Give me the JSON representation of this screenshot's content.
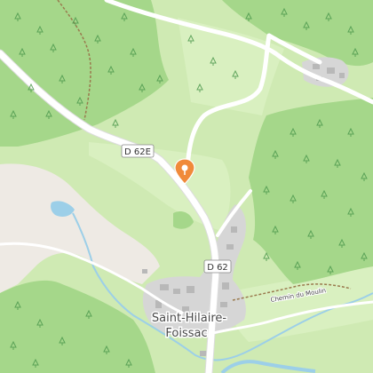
{
  "map": {
    "roads": [
      {
        "id": "road-d62e",
        "label": "D 62E"
      },
      {
        "id": "road-d62",
        "label": "D 62"
      }
    ],
    "paths": [
      {
        "id": "path-chemin-du-moulin",
        "label": "Chemin du Moulin"
      }
    ],
    "places": [
      {
        "id": "place-saint-hilaire-foissac",
        "label_line1": "Saint-Hilaire-",
        "label_line2": "Foissac"
      }
    ],
    "marker": {
      "icon": "location-pin-icon",
      "color": "#f08a3a"
    },
    "colors": {
      "background": "#cfeab3",
      "forest": "#a5d78a",
      "tree_symbol": "#4f9a4f",
      "meadow": "#d9f0c0",
      "bare_land": "#eeeae4",
      "water": "#9ccfe8",
      "residential": "#d6d6d6",
      "building": "#b8b8b8",
      "road": "#ffffff",
      "track": "#9a7a4e"
    }
  }
}
